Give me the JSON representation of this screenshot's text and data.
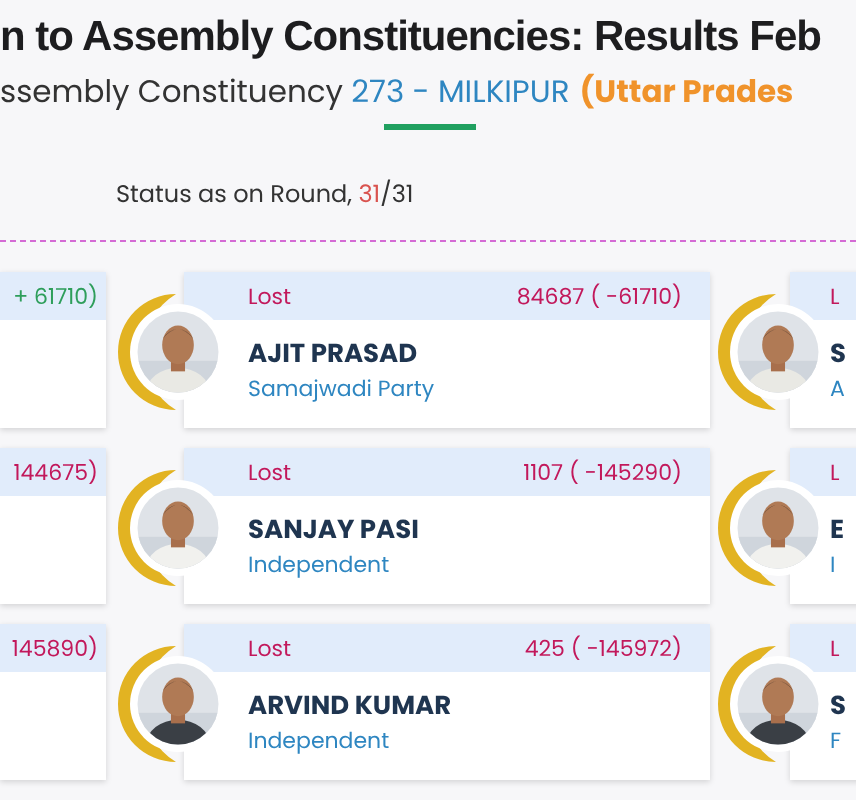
{
  "title": "n to Assembly Constituencies: Results Feb",
  "subtitle": {
    "prefix": "ssembly Constituency ",
    "constituency": "273 - MILKIPUR",
    "state": "(Uttar Prades"
  },
  "status": {
    "label": "Status as on Round, ",
    "current": "31",
    "total": "/31"
  },
  "rows": [
    {
      "left": {
        "votes": "+ 61710)",
        "color": "#2e9e5b"
      },
      "middle": {
        "status": "Lost",
        "votes": "84687 ( -61710)",
        "name": "AJIT PRASAD",
        "party": "Samajwadi Party"
      },
      "right": {
        "status": "L",
        "name": "S",
        "party": "A"
      }
    },
    {
      "left": {
        "votes": "144675)",
        "color": "#c2185b"
      },
      "middle": {
        "status": "Lost",
        "votes": "1107 ( -145290)",
        "name": "SANJAY PASI",
        "party": "Independent"
      },
      "right": {
        "status": "L",
        "name": "E",
        "party": "I"
      }
    },
    {
      "left": {
        "votes": "145890)",
        "color": "#c2185b"
      },
      "middle": {
        "status": "Lost",
        "votes": "425 ( -145972)",
        "name": "ARVIND KUMAR",
        "party": "Independent"
      },
      "right": {
        "status": "L",
        "name": "S",
        "party": "F"
      }
    }
  ]
}
